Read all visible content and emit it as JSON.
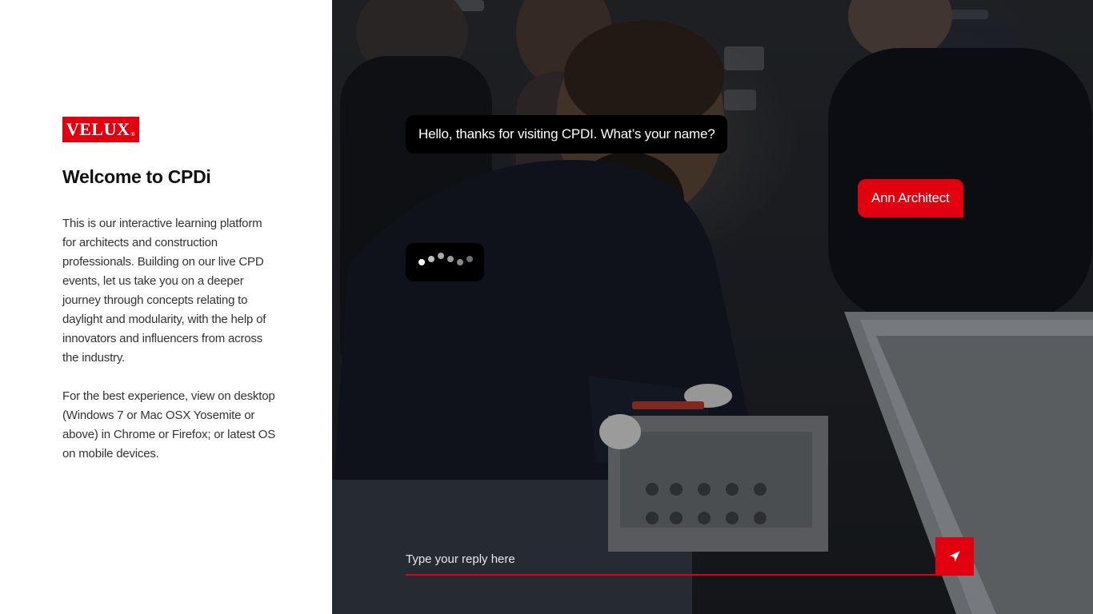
{
  "brand": {
    "logo_text": "VELUX",
    "logo_mark": "®",
    "color": "#e2000f"
  },
  "sidebar": {
    "title": "Welcome to CPDi",
    "paragraph_1": "This is our interactive learning platform for architects and construction professionals. Building on our live CPD events, let us take you on a deeper journey through concepts relating to daylight and modularity, with the help of innovators and influencers from across the industry.",
    "paragraph_2": "For the best experience, view on desktop (Windows 7 or Mac OSX Yosemite or above) in Chrome or Firefox; or latest OS on mobile devices."
  },
  "chat": {
    "bot_message": "Hello, thanks for visiting CPDI. What’s your name?",
    "user_message": "Ann Architect",
    "typing_icon": "typing-dots-icon",
    "reply_placeholder": "Type your reply here",
    "send_icon": "send-plane-icon"
  }
}
